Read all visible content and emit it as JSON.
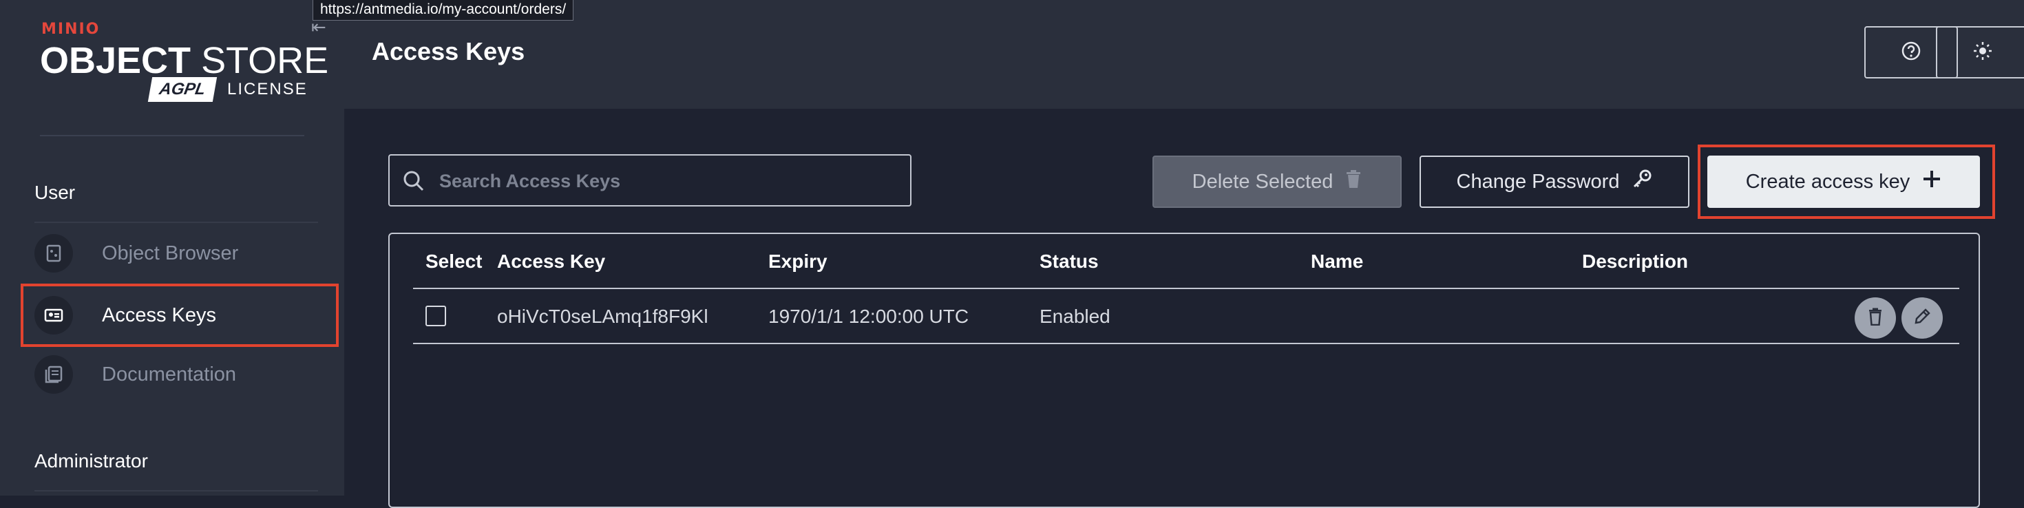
{
  "tooltip_url": "https://antmedia.io/my-account/orders/",
  "brand": {
    "minio": "MINIO",
    "object": "OBJECT",
    "store": "STORE",
    "agpl": "AGPL",
    "license": "LICENSE",
    "accent_color": "#e4473c"
  },
  "sidebar": {
    "section_user": "User",
    "items": [
      {
        "label": "Object Browser",
        "icon": "object-browser-icon"
      },
      {
        "label": "Access Keys",
        "icon": "access-keys-icon",
        "active": true
      },
      {
        "label": "Documentation",
        "icon": "documentation-icon"
      }
    ],
    "section_admin": "Administrator"
  },
  "header": {
    "title": "Access Keys",
    "help_icon": "help-circle-icon",
    "theme_icon": "sun-icon"
  },
  "toolbar": {
    "search_placeholder": "Search Access Keys",
    "delete_label": "Delete Selected",
    "change_password_label": "Change Password",
    "create_label": "Create access key",
    "highlight_color": "#e2432f"
  },
  "table": {
    "columns": [
      "Select",
      "Access Key",
      "Expiry",
      "Status",
      "Name",
      "Description"
    ],
    "rows": [
      {
        "access_key": "oHiVcT0seLAmq1f8F9Kl",
        "expiry": "1970/1/1 12:00:00 UTC",
        "status": "Enabled",
        "name": "",
        "description": ""
      }
    ]
  }
}
